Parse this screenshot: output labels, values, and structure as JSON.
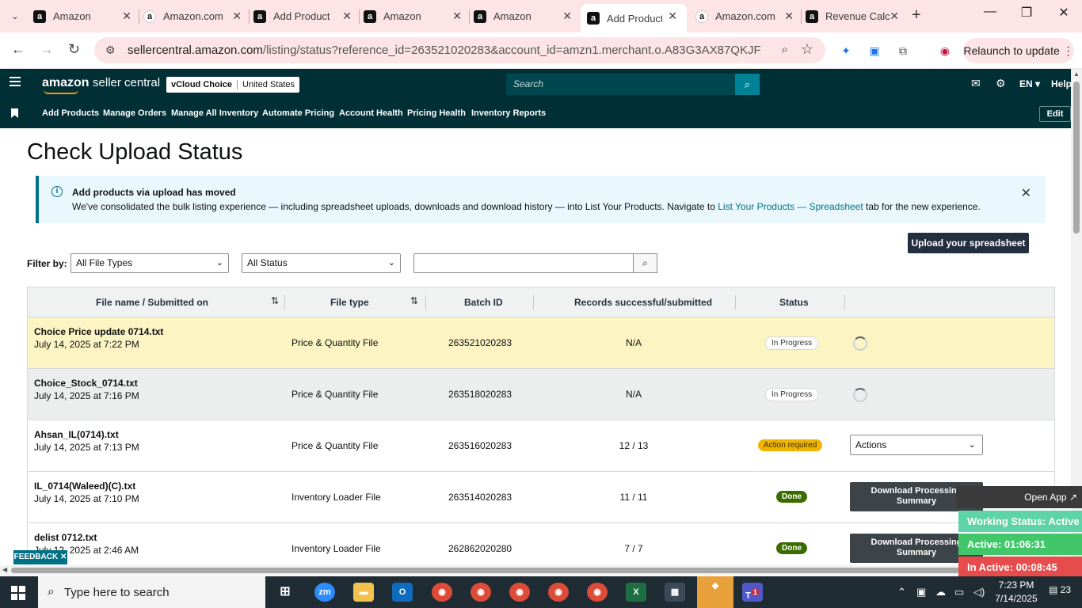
{
  "browser": {
    "tabs": [
      {
        "title": "Amazon",
        "icon": "amazon-a-icon"
      },
      {
        "title": "Amazon.com",
        "icon": "amazon-smile-icon"
      },
      {
        "title": "Add Product",
        "icon": "amazon-a-icon"
      },
      {
        "title": "Amazon",
        "icon": "amazon-a-icon"
      },
      {
        "title": "Amazon",
        "icon": "amazon-a-icon"
      },
      {
        "title": "Add Product",
        "icon": "amazon-a-icon",
        "active": true
      },
      {
        "title": "Amazon.com",
        "icon": "amazon-smile-icon"
      },
      {
        "title": "Revenue Calc",
        "icon": "amazon-a-icon"
      }
    ],
    "url_host": "sellercentral.amazon.com",
    "url_path": "/listing/status?reference_id=263521020283&account_id=amzn1.merchant.o.A83G3AX87QKJF",
    "relaunch_label": "Relaunch to update"
  },
  "header": {
    "brand": "amazon",
    "brand_suffix": "seller central",
    "account_name": "vCloud Choice",
    "marketplace": "United States",
    "search_placeholder": "Search",
    "language": "EN",
    "help": "Help"
  },
  "nav": {
    "items": [
      "Add Products",
      "Manage Orders",
      "Manage All Inventory",
      "Automate Pricing",
      "Account Health",
      "Pricing Health",
      "Inventory Reports"
    ],
    "edit": "Edit"
  },
  "page": {
    "title": "Check Upload Status",
    "alert": {
      "title": "Add products via upload has moved",
      "body_prefix": "We've consolidated the bulk listing experience — including spreadsheet uploads, downloads and download history — into List Your Products. Navigate to ",
      "link": "List Your Products — Spreadsheet",
      "body_suffix": " tab for the new experience."
    },
    "upload_button": "Upload your spreadsheet",
    "filter_label": "Filter by:",
    "file_type_filter": "All File Types",
    "status_filter": "All Status"
  },
  "table": {
    "columns": [
      "File name / Submitted on",
      "File type",
      "Batch ID",
      "Records successful/submitted",
      "Status"
    ],
    "rows": [
      {
        "name": "Choice Price update 0714.txt",
        "date": "July 14, 2025 at 7:22 PM",
        "type": "Price & Quantity File",
        "batch": "263521020283",
        "records": "N/A",
        "status": "In Progress",
        "action": "spinner"
      },
      {
        "name": "Choice_Stock_0714.txt",
        "date": "July 14, 2025 at 7:16 PM",
        "type": "Price & Quantity File",
        "batch": "263518020283",
        "records": "N/A",
        "status": "In Progress",
        "action": "spinner"
      },
      {
        "name": "Ahsan_IL(0714).txt",
        "date": "July 14, 2025 at 7:13 PM",
        "type": "Price & Quantity File",
        "batch": "263516020283",
        "records": "12 / 13",
        "status": "Action required",
        "action": "Actions"
      },
      {
        "name": "IL_0714(Waleed)(C).txt",
        "date": "July 14, 2025 at 7:10 PM",
        "type": "Inventory Loader File",
        "batch": "263514020283",
        "records": "11 / 11",
        "status": "Done",
        "action": "Download Processing Summary"
      },
      {
        "name": "delist 0712.txt",
        "date": "July 12, 2025 at 2:46 AM",
        "type": "Inventory Loader File",
        "batch": "262862020280",
        "records": "7 / 7",
        "status": "Done",
        "action": "Download Processing Summary"
      }
    ]
  },
  "feedback": "FEEDBACK",
  "widget": {
    "open_app": "Open App",
    "working_status": "Working Status: Active",
    "active": "Active: 01:06:31",
    "inactive": "In Active: 00:08:45"
  },
  "taskbar": {
    "search_placeholder": "Type here to search",
    "time": "7:23 PM",
    "date": "7/14/2025",
    "notifications": "23",
    "teams_badge": "1"
  }
}
